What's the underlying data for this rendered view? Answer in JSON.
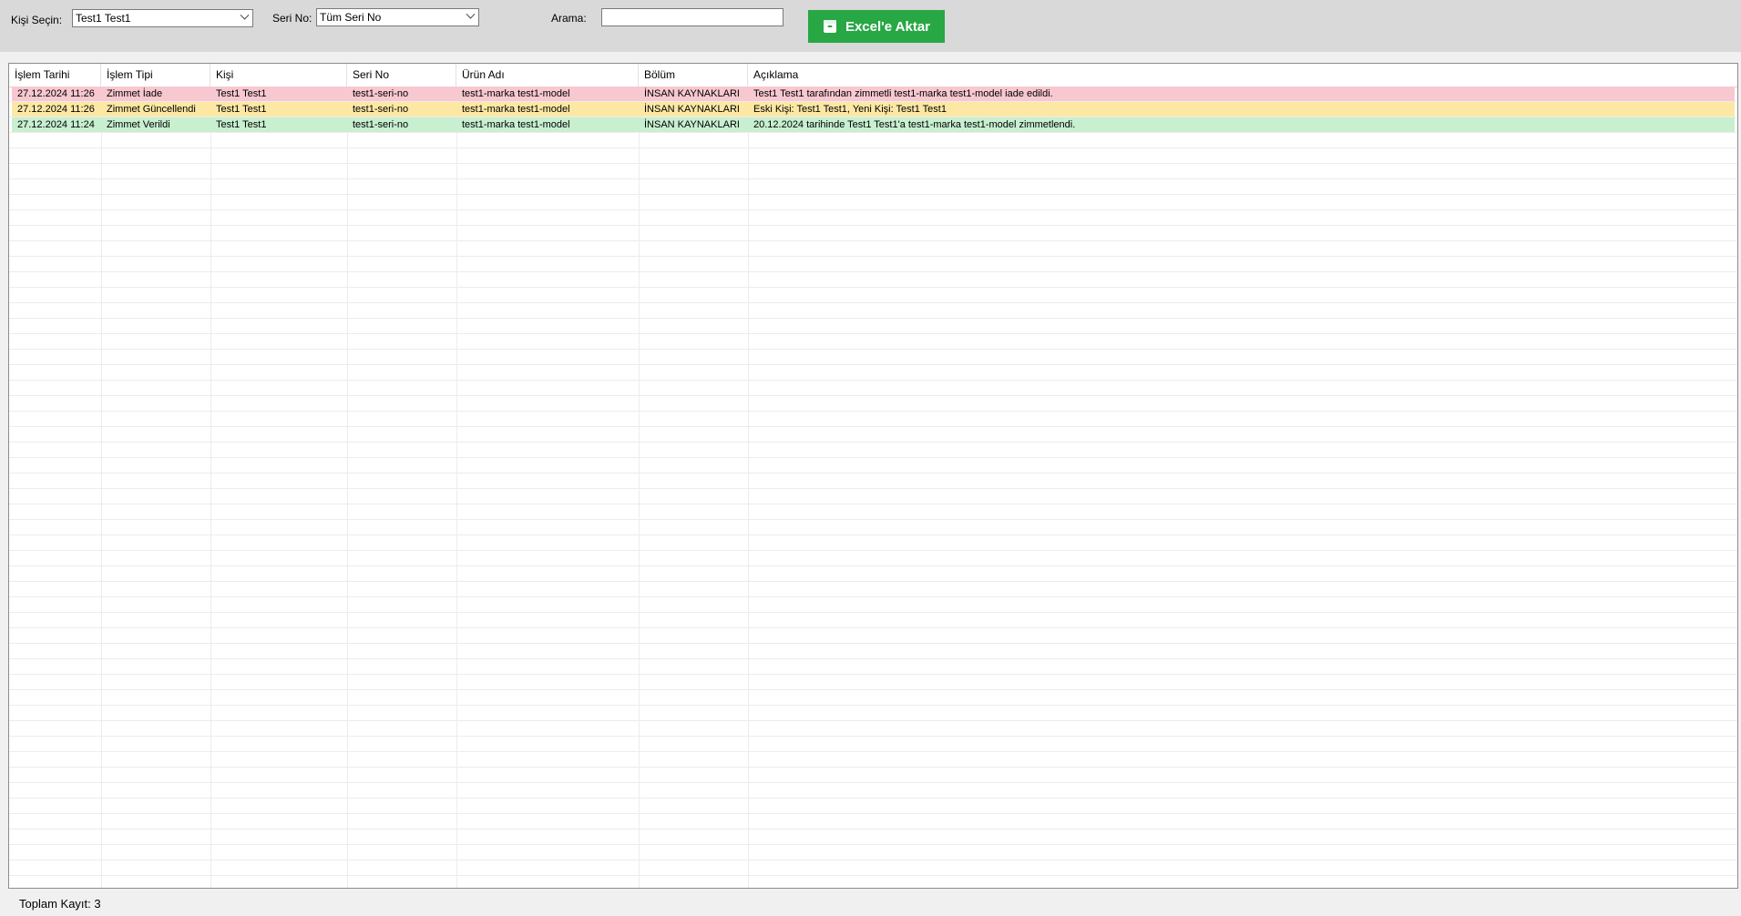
{
  "toolbar": {
    "person_label": "Kişi Seçin:",
    "person_value": "Test1 Test1",
    "serial_label": "Seri No:",
    "serial_value": "Tüm Seri No",
    "search_label": "Arama:",
    "search_value": "",
    "export_label": "Excel'e Aktar",
    "export_color": "#28a745"
  },
  "grid": {
    "columns": [
      "İşlem Tarihi",
      "İşlem Tipi",
      "Kişi",
      "Seri No",
      "Ürün Adı",
      "Bölüm",
      "Açıklama"
    ],
    "rows": [
      {
        "bg": "#f8c8d0",
        "cells": [
          "27.12.2024 11:26",
          "Zimmet İade",
          "Test1 Test1",
          "test1-seri-no",
          "test1-marka test1-model",
          "İNSAN KAYNAKLARI",
          "Test1 Test1 tarafından zimmetli test1-marka test1-model iade edildi."
        ]
      },
      {
        "bg": "#fce8a4",
        "cells": [
          "27.12.2024 11:26",
          "Zimmet Güncellendi",
          "Test1 Test1",
          "test1-seri-no",
          "test1-marka test1-model",
          "İNSAN KAYNAKLARI",
          "Eski Kişi: Test1 Test1, Yeni Kişi: Test1 Test1"
        ]
      },
      {
        "bg": "#c8efd0",
        "cells": [
          "27.12.2024 11:24",
          "Zimmet Verildi",
          "Test1 Test1",
          "test1-seri-no",
          "test1-marka test1-model",
          "İNSAN KAYNAKLARI",
          "20.12.2024 tarihinde Test1 Test1'a test1-marka test1-model zimmetlendi."
        ]
      }
    ]
  },
  "status": {
    "total_label": "Toplam Kayıt: 3"
  }
}
